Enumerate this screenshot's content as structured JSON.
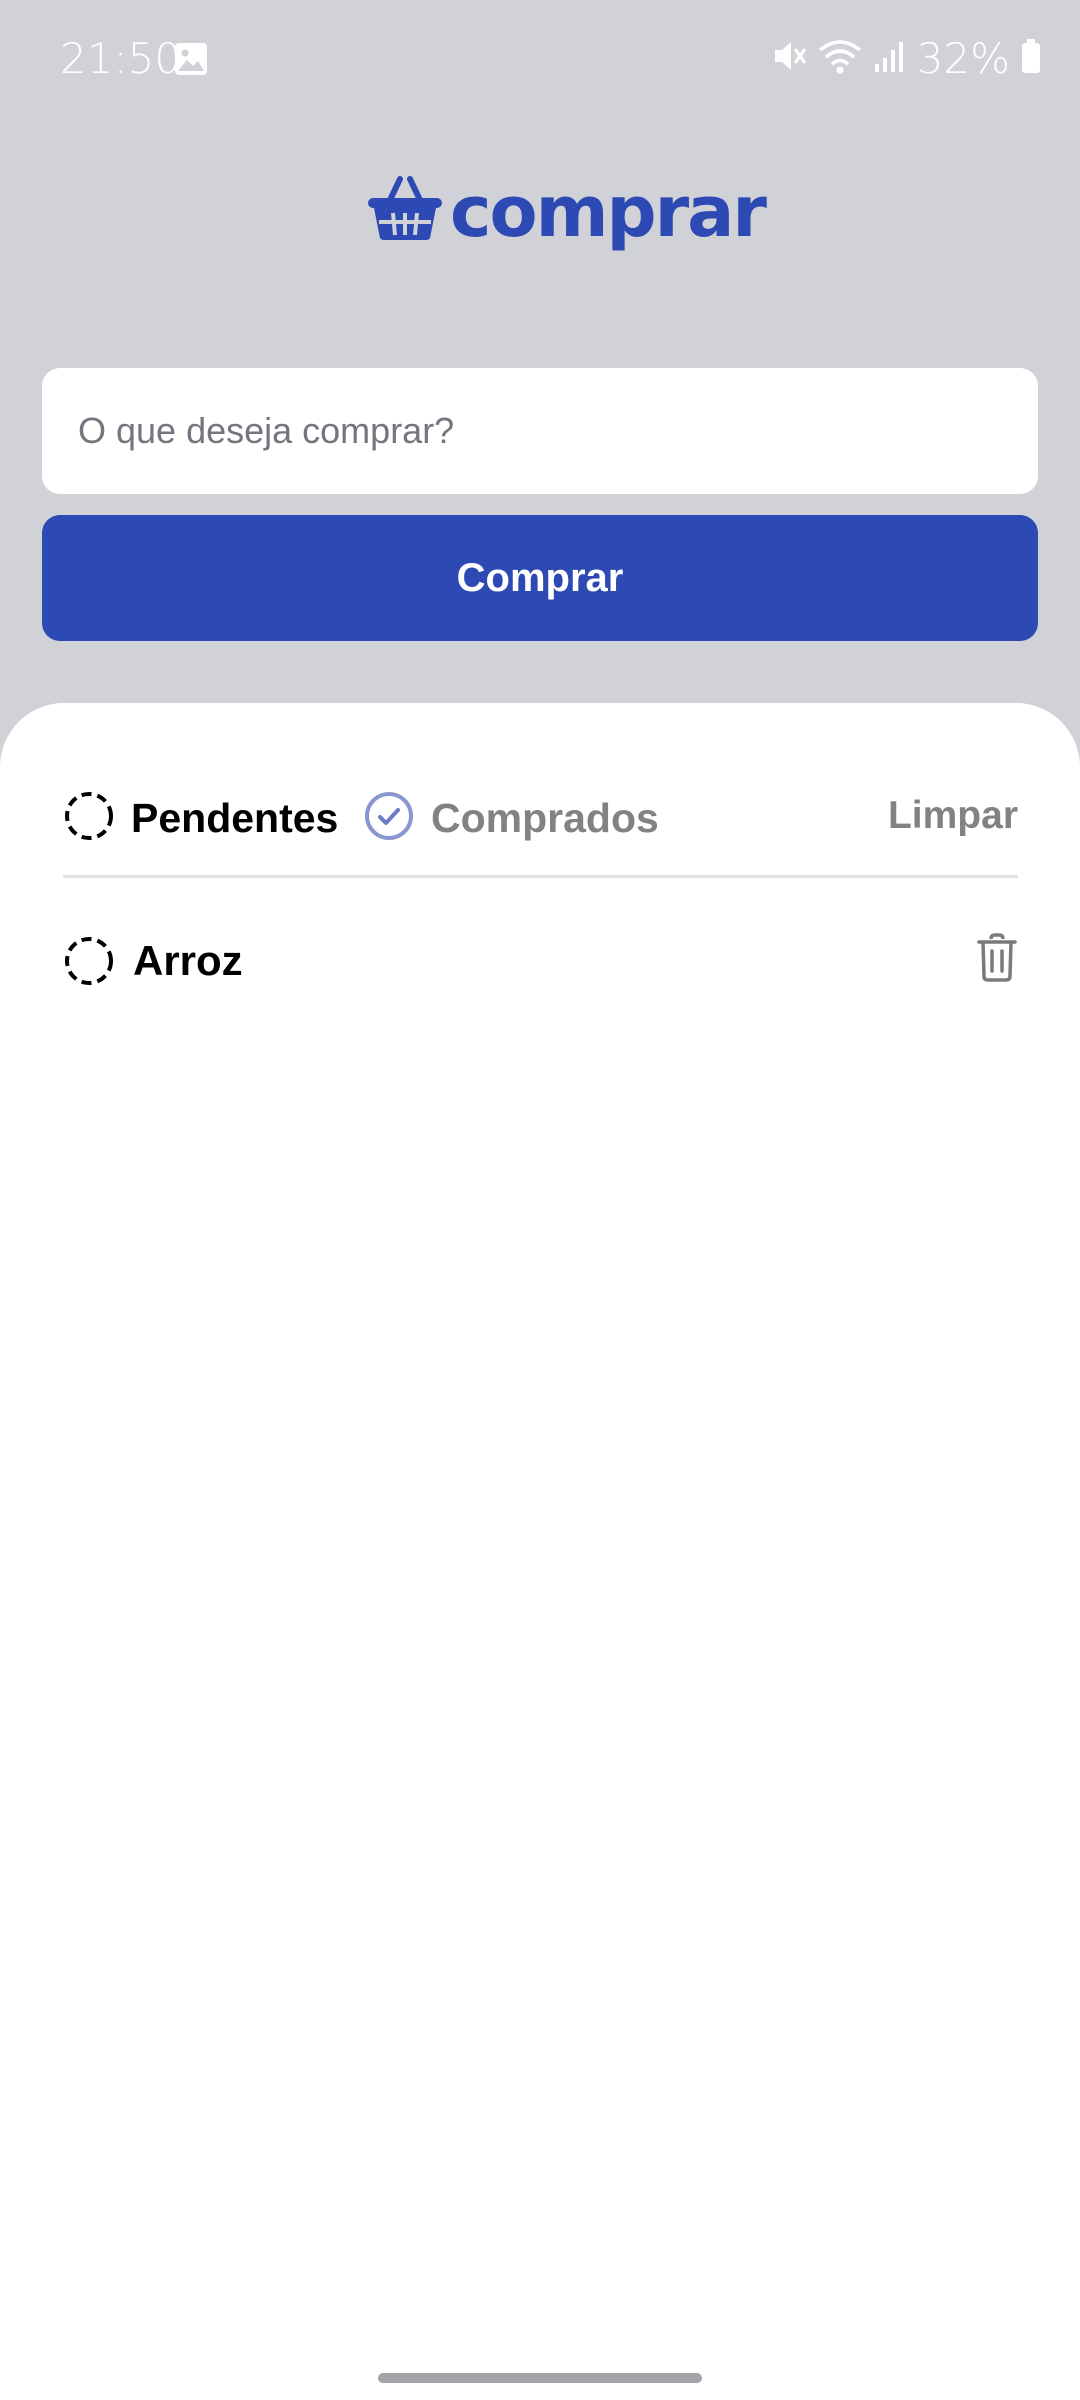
{
  "status_bar": {
    "time": "21:50",
    "battery": "32%",
    "icons": [
      "image-icon",
      "mute-icon",
      "wifi-icon",
      "signal-icon",
      "battery-icon"
    ]
  },
  "app": {
    "logo_text": "comprar",
    "brand_color": "#2d49b3"
  },
  "search": {
    "placeholder": "O que deseja comprar?",
    "value": ""
  },
  "buy_button": {
    "label": "Comprar"
  },
  "filters": {
    "pendentes": "Pendentes",
    "comprados": "Comprados",
    "active": "pendentes",
    "clear_label": "Limpar"
  },
  "items": [
    {
      "label": "Arroz",
      "status": "pending"
    }
  ]
}
